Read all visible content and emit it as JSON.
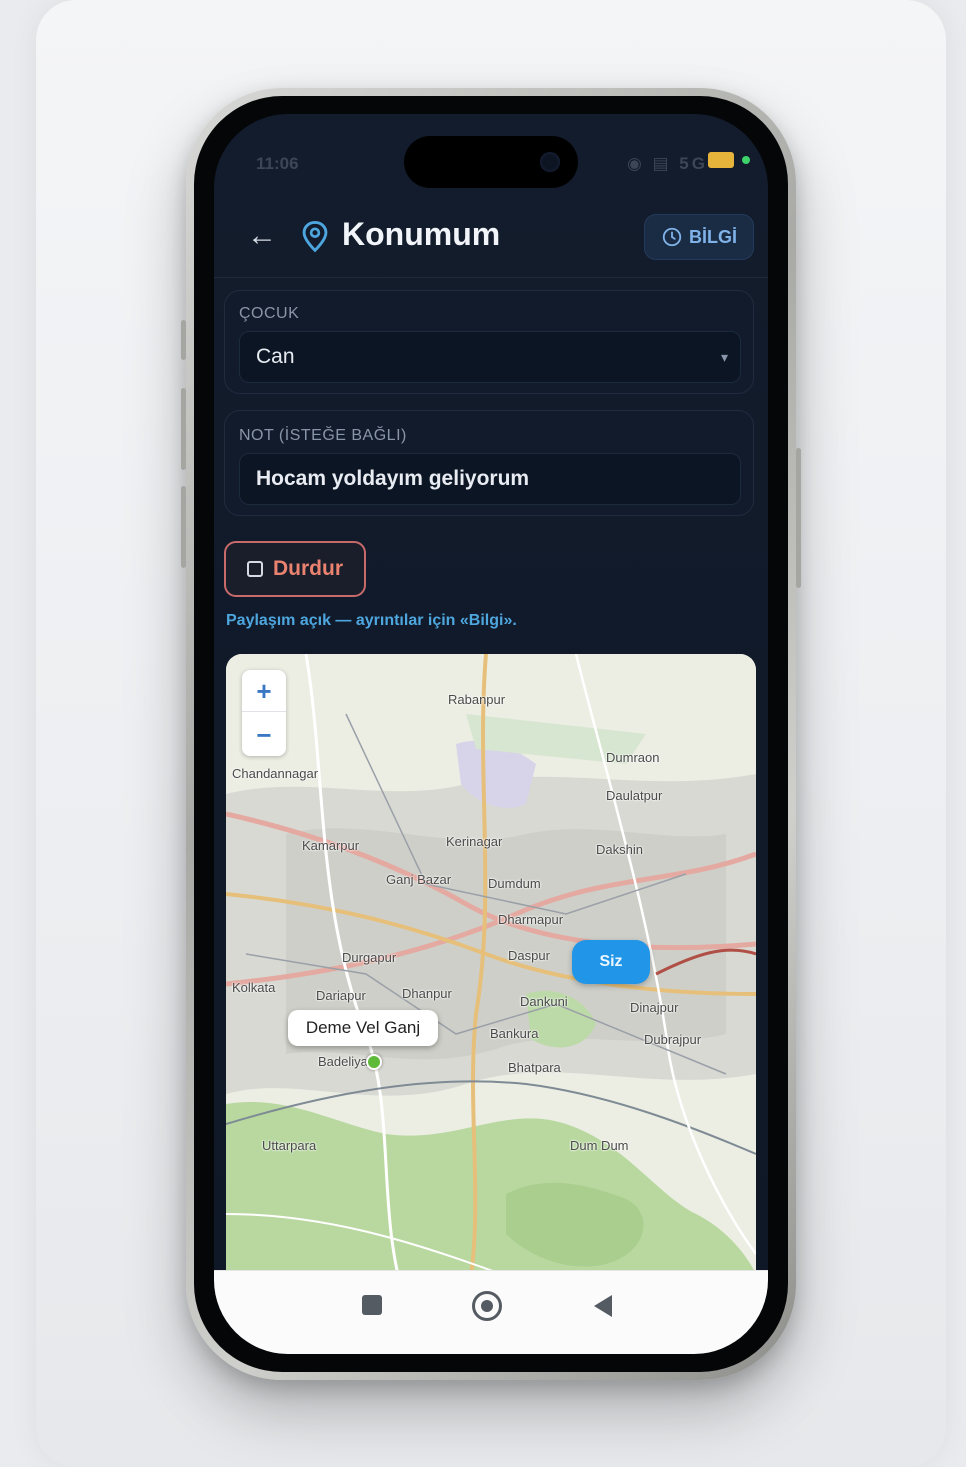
{
  "status_bar": {
    "time": "11:06",
    "icons": "◉ ▤ 5G"
  },
  "header": {
    "title": "Konumum",
    "info_label": "BİLGİ"
  },
  "child_card": {
    "label": "ÇOCUK",
    "selected_child": "Can"
  },
  "note_card": {
    "label": "NOT (İSTEĞE BAĞLI)",
    "value": "Hocam yoldayım geliyorum"
  },
  "stop_button": {
    "label": "Durdur"
  },
  "hint": {
    "text": "Paylaşım açık — ayrıntılar için «Bilgi»."
  },
  "map": {
    "zoom_in": "+",
    "zoom_out": "−",
    "callout_text": "Deme Vel Ganj",
    "badge_text": "Siz",
    "labels": [
      "Rabanpur",
      "Daulatpur",
      "Kamarpur",
      "Kerinagar",
      "Dakshin",
      "Ganj Bazar",
      "Dumdum",
      "Dharmapur",
      "Durgapur",
      "Daspur",
      "Dariapur",
      "Dhanpur",
      "Dankuni",
      "Dinajpur",
      "Dubrajpur",
      "Bankura",
      "Bhatpara",
      "Uttarpara",
      "Dum Dum",
      "Chandannagar",
      "Kolkata",
      "Badeliya",
      "Dumraon"
    ]
  },
  "colors": {
    "accent": "#2196e8",
    "danger": "#e9826f",
    "link": "#4ea6df",
    "screen_bg": "#121c2c"
  },
  "icons": {
    "back": "arrow-left-icon",
    "location": "map-pin-icon",
    "info": "clock-info-icon",
    "stop": "square-icon"
  }
}
